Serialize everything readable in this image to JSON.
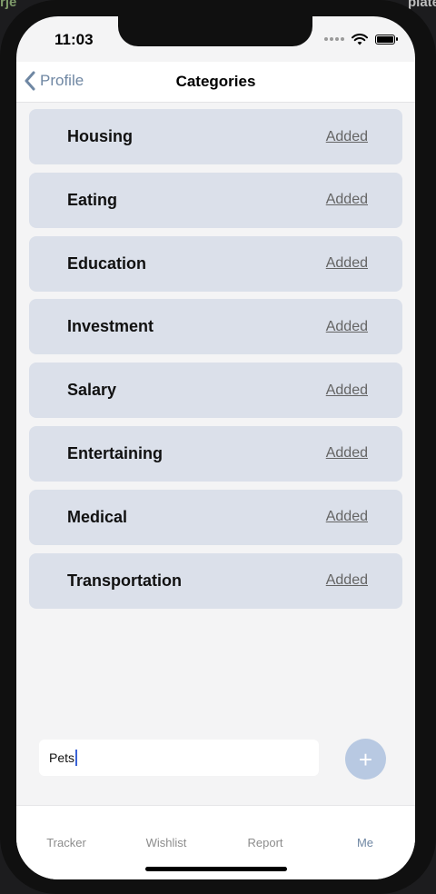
{
  "background": {
    "left_text": "rje",
    "right_text": "plate"
  },
  "status_bar": {
    "time": "11:03"
  },
  "nav": {
    "back_label": "Profile",
    "title": "Categories"
  },
  "categories": [
    {
      "name": "Housing",
      "status": "Added"
    },
    {
      "name": "Eating",
      "status": "Added"
    },
    {
      "name": "Education",
      "status": "Added"
    },
    {
      "name": "Investment",
      "status": "Added"
    },
    {
      "name": "Salary",
      "status": "Added"
    },
    {
      "name": "Entertaining",
      "status": "Added"
    },
    {
      "name": "Medical",
      "status": "Added"
    },
    {
      "name": "Transportation",
      "status": "Added"
    }
  ],
  "new_category": {
    "value": "Pets",
    "add_icon": "plus-icon"
  },
  "tabs": [
    {
      "label": "Tracker",
      "active": false
    },
    {
      "label": "Wishlist",
      "active": false
    },
    {
      "label": "Report",
      "active": false
    },
    {
      "label": "Me",
      "active": true
    }
  ],
  "colors": {
    "accent": "#6f87a3",
    "card_bg": "#dbe0ea",
    "add_button_bg": "#b8c9e2",
    "screen_bg": "#f4f4f5"
  }
}
